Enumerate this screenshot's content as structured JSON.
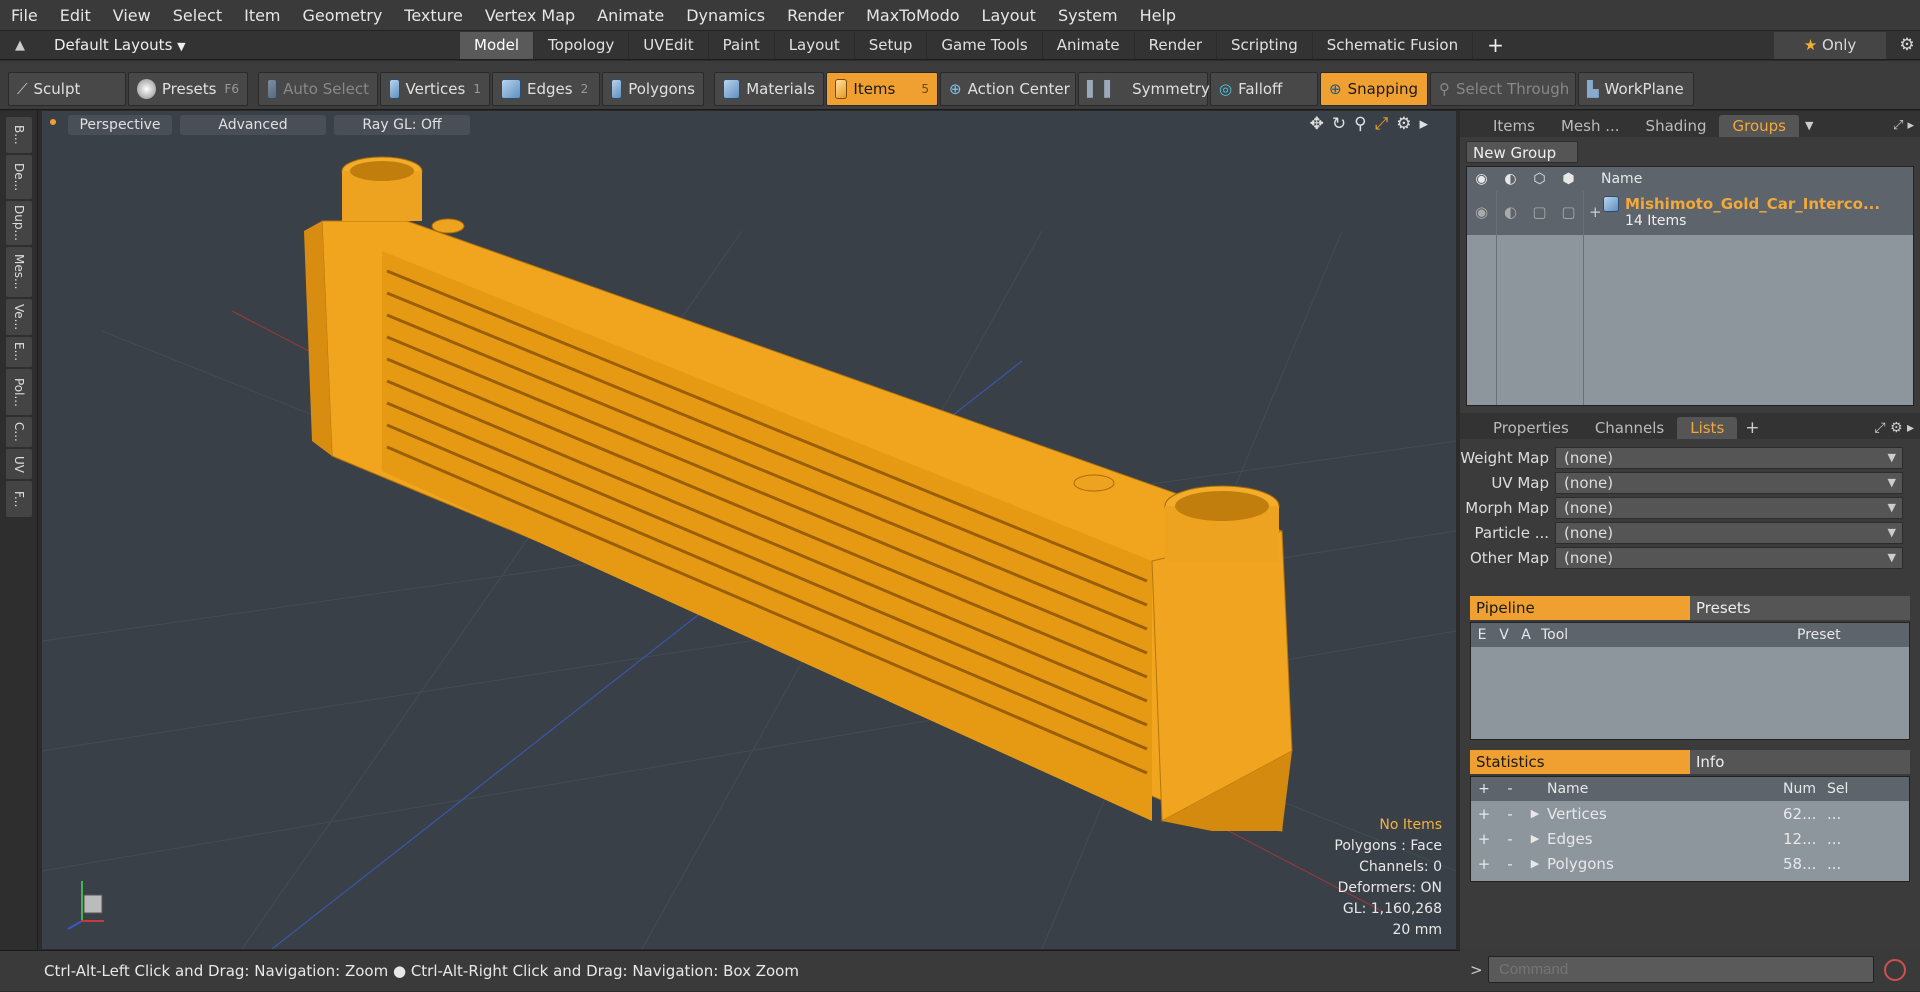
{
  "menu": [
    "File",
    "Edit",
    "View",
    "Select",
    "Item",
    "Geometry",
    "Texture",
    "Vertex Map",
    "Animate",
    "Dynamics",
    "Render",
    "MaxToModo",
    "Layout",
    "System",
    "Help"
  ],
  "layout": {
    "preset": "Default Layouts",
    "tabs": [
      "Model",
      "Topology",
      "UVEdit",
      "Paint",
      "Layout",
      "Setup",
      "Game Tools",
      "Animate",
      "Render",
      "Scripting",
      "Schematic Fusion"
    ],
    "only_label": "Only"
  },
  "toolbar": {
    "sculpt": "Sculpt",
    "presets": "Presets",
    "presets_key": "F6",
    "auto_select": "Auto Select",
    "vertices": "Vertices",
    "vertices_key": "1",
    "edges": "Edges",
    "edges_key": "2",
    "polygons": "Polygons",
    "materials": "Materials",
    "items": "Items",
    "items_key": "5",
    "action_center": "Action Center",
    "symmetry": "Symmetry",
    "falloff": "Falloff",
    "snapping": "Snapping",
    "select_through": "Select Through",
    "workplane": "WorkPlane"
  },
  "left_tabs": [
    "B...",
    "De...",
    "Dup...",
    "Mes...",
    "Ve...",
    "E...",
    "Pol...",
    "C...",
    "UV",
    "F..."
  ],
  "viewport": {
    "view": "Perspective",
    "mode": "Advanced",
    "raygl": "Ray GL: Off",
    "info": {
      "items": "No Items",
      "polygons": "Polygons : Face",
      "channels": "Channels: 0",
      "deformers": "Deformers: ON",
      "gl": "GL: 1,160,268",
      "scale": "20 mm"
    }
  },
  "status": "Ctrl-Alt-Left Click and Drag: Navigation: Zoom ● Ctrl-Alt-Right Click and Drag: Navigation: Box Zoom",
  "groups_panel": {
    "tabs": [
      "Items",
      "Mesh ...",
      "Shading",
      "Groups"
    ],
    "new_group": "New Group",
    "name_col": "Name",
    "group_name": "Mishimoto_Gold_Car_Interco...",
    "group_count": "14 Items"
  },
  "props_panel": {
    "tabs": [
      "Properties",
      "Channels",
      "Lists"
    ],
    "rows": [
      {
        "label": "Weight Map",
        "value": "(none)"
      },
      {
        "label": "UV Map",
        "value": "(none)"
      },
      {
        "label": "Morph Map",
        "value": "(none)"
      },
      {
        "label": "Particle ...",
        "value": "(none)"
      },
      {
        "label": "Other Map",
        "value": "(none)"
      }
    ]
  },
  "pipeline": {
    "tab1": "Pipeline",
    "tab2": "Presets",
    "cols": [
      "E",
      "V",
      "A",
      "Tool",
      "Preset"
    ]
  },
  "stats": {
    "tab1": "Statistics",
    "tab2": "Info",
    "cols": [
      "+",
      "-",
      "Name",
      "Num",
      "Sel"
    ],
    "rows": [
      {
        "name": "Vertices",
        "num": "62...",
        "sel": "..."
      },
      {
        "name": "Edges",
        "num": "12...",
        "sel": "..."
      },
      {
        "name": "Polygons",
        "num": "58...",
        "sel": "..."
      }
    ]
  },
  "command": {
    "placeholder": "Command"
  },
  "colors": {
    "accent": "#f0a030",
    "model": "#f5a623"
  }
}
